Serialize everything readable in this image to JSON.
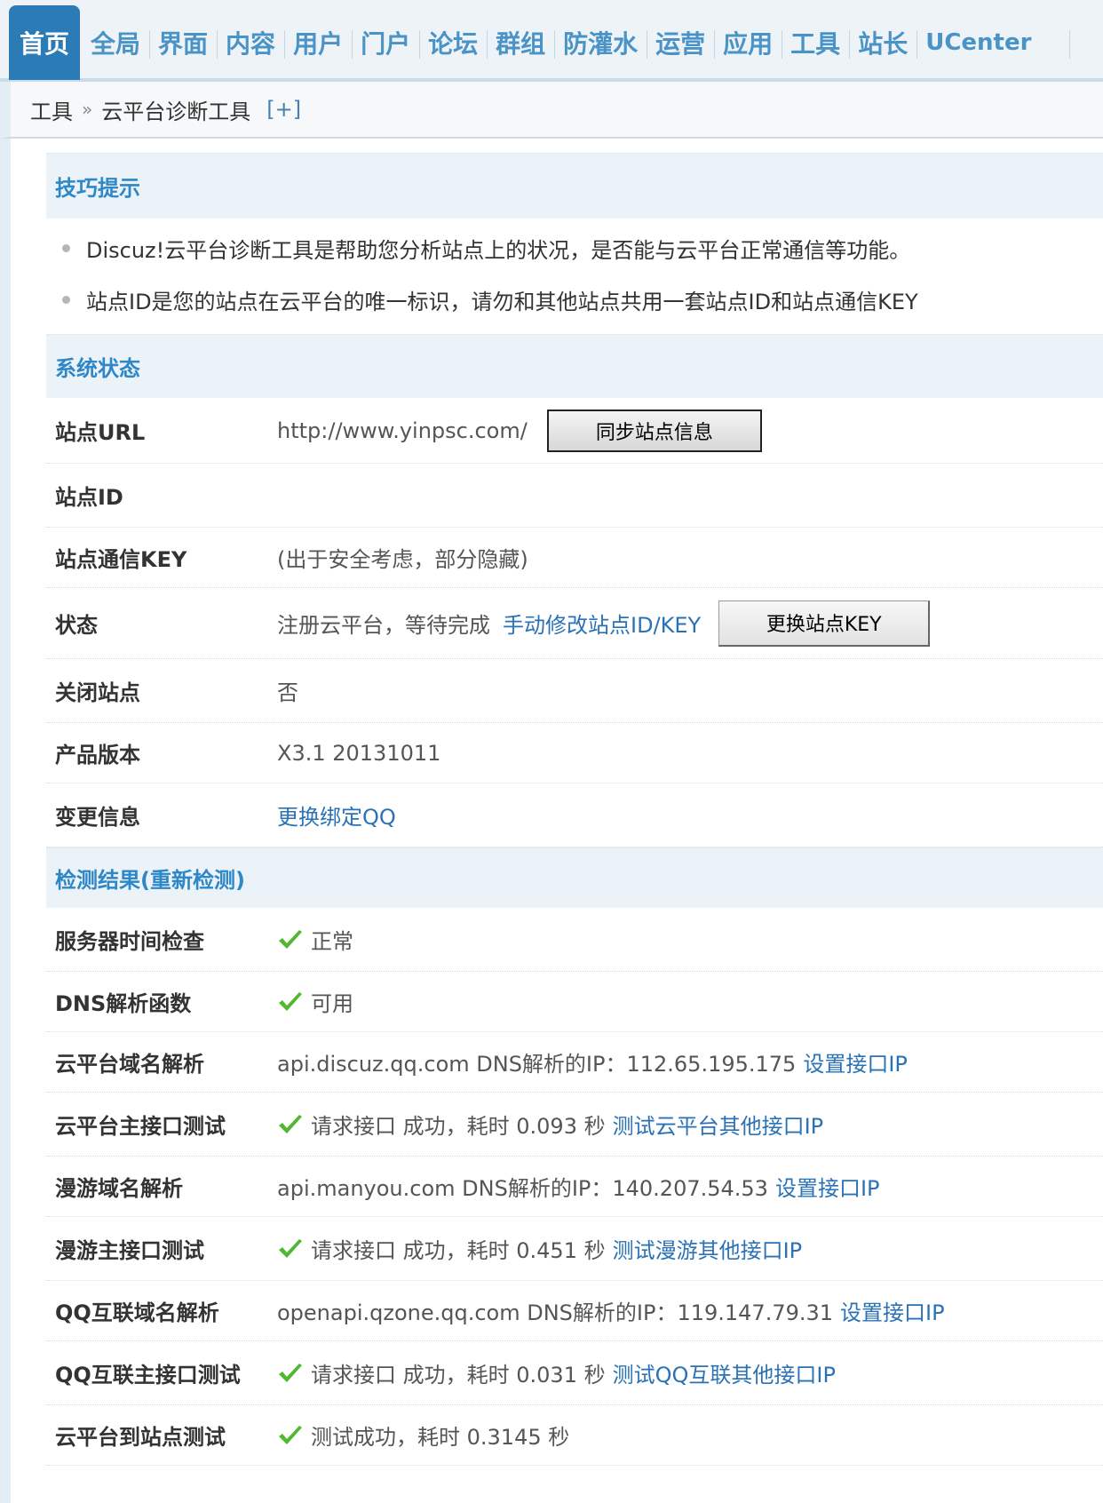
{
  "nav": {
    "tabs": [
      "首页",
      "全局",
      "界面",
      "内容",
      "用户",
      "门户",
      "论坛",
      "群组",
      "防灌水",
      "运营",
      "应用",
      "工具",
      "站长",
      "UCenter"
    ],
    "active": "首页"
  },
  "breadcrumb": {
    "parent": "工具",
    "separator": "»",
    "current": "云平台诊断工具",
    "toggle": "[+]"
  },
  "tips": {
    "title": "技巧提示",
    "items": [
      "Discuz!云平台诊断工具是帮助您分析站点上的状况，是否能与云平台正常通信等功能。",
      "站点ID是您的站点在云平台的唯一标识，请勿和其他站点共用一套站点ID和站点通信KEY"
    ]
  },
  "status": {
    "title": "系统状态",
    "site_url_label": "站点URL",
    "site_url": "http://www.yinpsc.com/",
    "sync_button": "同步站点信息",
    "site_id_label": "站点ID",
    "site_id": "",
    "site_key_label": "站点通信KEY",
    "site_key": "(出于安全考虑，部分隐藏)",
    "state_label": "状态",
    "state_text": "注册云平台，等待完成",
    "state_link": "手动修改站点ID/KEY",
    "change_key_button": "更换站点KEY",
    "closed_label": "关闭站点",
    "closed_value": "否",
    "version_label": "产品版本",
    "version_value": "X3.1 20131011",
    "change_label": "变更信息",
    "change_link": "更换绑定QQ"
  },
  "results": {
    "title": "检测结果(重新检测)",
    "server_time_label": "服务器时间检查",
    "server_time_value": "正常",
    "dns_label": "DNS解析函数",
    "dns_value": "可用",
    "cloud_dns_label": "云平台域名解析",
    "cloud_dns_text": "api.discuz.qq.com DNS解析的IP：112.65.195.175",
    "cloud_dns_link": "设置接口IP",
    "cloud_api_label": "云平台主接口测试",
    "cloud_api_text": "请求接口 成功，耗时 0.093 秒",
    "cloud_api_link": "测试云平台其他接口IP",
    "manyou_dns_label": "漫游域名解析",
    "manyou_dns_text": "api.manyou.com DNS解析的IP：140.207.54.53",
    "manyou_dns_link": "设置接口IP",
    "manyou_api_label": "漫游主接口测试",
    "manyou_api_text": "请求接口 成功，耗时 0.451 秒",
    "manyou_api_link": "测试漫游其他接口IP",
    "qq_dns_label": "QQ互联域名解析",
    "qq_dns_text": "openapi.qzone.qq.com DNS解析的IP：119.147.79.31",
    "qq_dns_link": "设置接口IP",
    "qq_api_label": "QQ互联主接口测试",
    "qq_api_text": "请求接口 成功，耗时 0.031 秒",
    "qq_api_link": "测试QQ互联其他接口IP",
    "site_test_label": "云平台到站点测试",
    "site_test_text": "测试成功，耗时 0.3145 秒"
  },
  "colors": {
    "accent": "#2b7bb6",
    "link": "#2a72b5",
    "section_head": "#2e87c6",
    "check": "#4fb82f"
  }
}
